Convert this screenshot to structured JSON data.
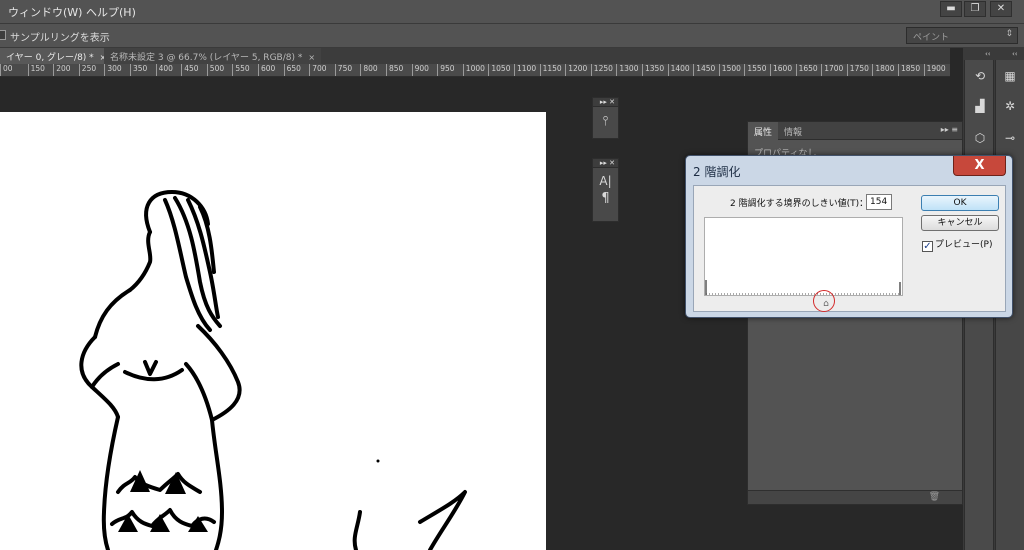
{
  "menubar": {
    "items": [
      "ウィンドウ(W)",
      "ヘルプ(H)"
    ],
    "window_buttons": [
      "▬",
      "❐",
      "✕"
    ]
  },
  "optionsbar": {
    "sampling_label": "サンプルリングを表示",
    "workspace_value": "ペイント"
  },
  "tabs": [
    {
      "label": "イヤー 0, グレー/8) *",
      "close": "×"
    },
    {
      "label": "名称未設定 3 @ 66.7% (レイヤー 5, RGB/8) *",
      "close": "×"
    }
  ],
  "ruler": {
    "ticks": [
      "00",
      "150",
      "200",
      "250",
      "300",
      "350",
      "400",
      "450",
      "500",
      "550",
      "600",
      "650",
      "700",
      "750",
      "800",
      "850",
      "900",
      "950",
      "1000",
      "1050",
      "1100",
      "1150",
      "1200",
      "1250",
      "1300",
      "1350",
      "1400",
      "1450",
      "1500",
      "1550",
      "1600",
      "1650",
      "1700",
      "1750",
      "1800",
      "1850",
      "1900"
    ]
  },
  "properties_panel": {
    "tab_active": "属性",
    "tab_inactive": "情報",
    "empty_text": "プロパティなし",
    "menu": "▸▸ ≡"
  },
  "floating_panels": {
    "header": "▸▸ ✕",
    "icon_a": "A|",
    "icon_p": "¶"
  },
  "dialog": {
    "title": "2 階調化",
    "close": "X",
    "threshold_label": "2 階調化する境界のしきい値(T)：",
    "threshold_value": "154",
    "ok_label": "OK",
    "cancel_label": "キャンセル",
    "preview_label": "プレビュー(P)",
    "preview_checked": "✓",
    "slider_glyph": "⌂"
  },
  "colors": {
    "app_bg": "#282828",
    "panel_bg": "#535353",
    "dialog_frame": "#cbd7e6",
    "close_red": "#c7483b",
    "highlight_ring": "#d42a2a"
  }
}
